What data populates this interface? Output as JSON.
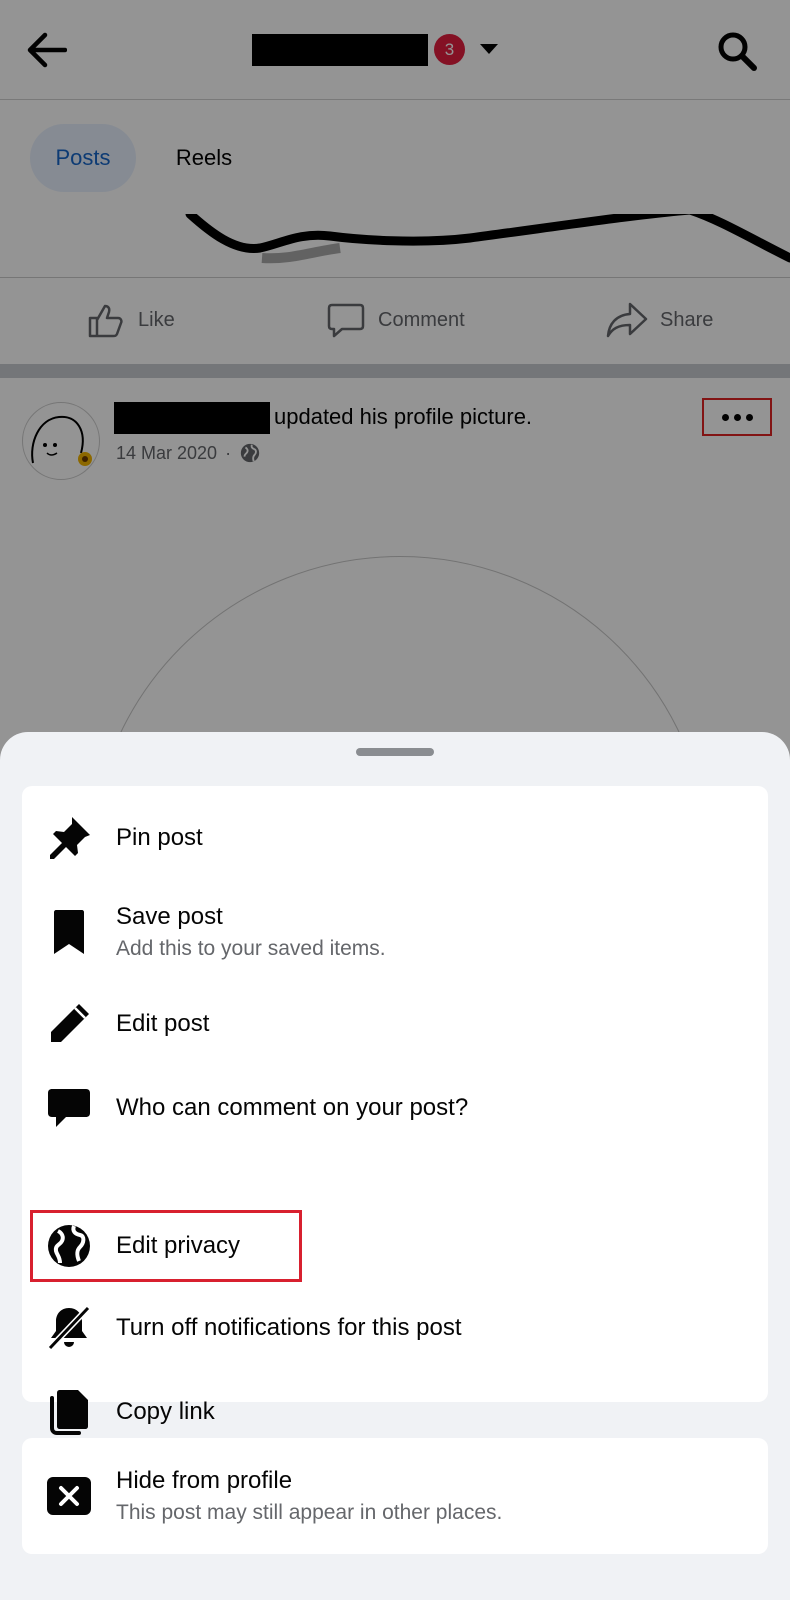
{
  "header": {
    "notification_count": "3",
    "colors": {
      "badge": "#e41e3f",
      "accent": "#1866c8"
    }
  },
  "tabs": [
    {
      "label": "Posts",
      "active": true
    },
    {
      "label": "Reels",
      "active": false
    }
  ],
  "post_actions": {
    "like": "Like",
    "comment": "Comment",
    "share": "Share"
  },
  "post": {
    "text": "updated his profile picture.",
    "date": "14 Mar 2020",
    "audience_icon": "globe-icon"
  },
  "menu": {
    "items": [
      {
        "label": "Pin post",
        "sub": "",
        "icon": "pin-icon"
      },
      {
        "label": "Save post",
        "sub": "Add this to your saved items.",
        "icon": "bookmark-icon"
      },
      {
        "label": "Edit post",
        "sub": "",
        "icon": "pencil-icon"
      },
      {
        "label": "Who can comment on your post?",
        "sub": "",
        "icon": "comment-bubble-icon"
      },
      {
        "label": "Edit privacy",
        "sub": "",
        "icon": "globe-icon",
        "highlighted": true
      },
      {
        "label": "Turn off notifications for this post",
        "sub": "",
        "icon": "bell-off-icon"
      },
      {
        "label": "Copy link",
        "sub": "",
        "icon": "copy-icon"
      }
    ],
    "hide": {
      "label": "Hide from profile",
      "sub": "This post may still appear in other places.",
      "icon": "close-box-icon"
    }
  },
  "annotation_color": "#d8202f"
}
